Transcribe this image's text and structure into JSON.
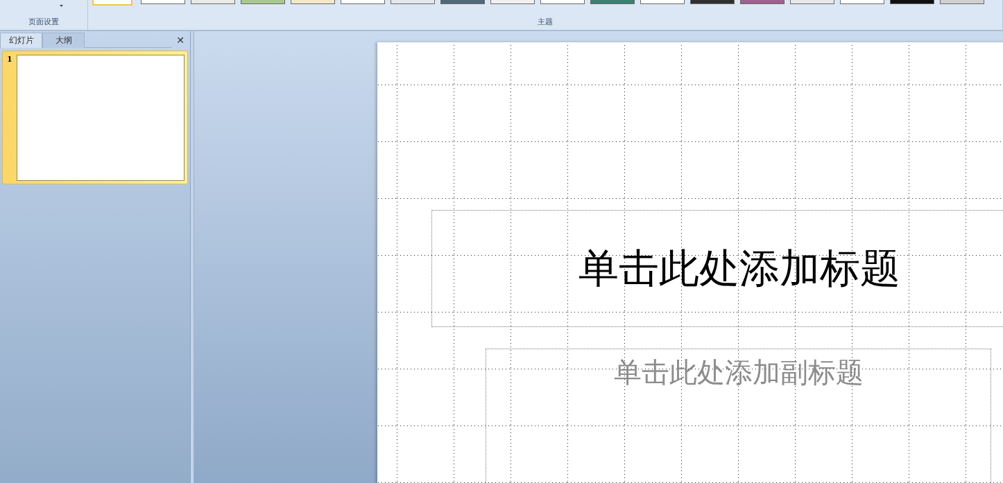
{
  "ribbon": {
    "groups": [
      {
        "label": "页面设置",
        "kind": "page_setup"
      },
      {
        "label": "主题",
        "kind": "themes"
      }
    ],
    "themes": [
      {
        "selected": true,
        "color": "#ffffff"
      },
      {
        "selected": false,
        "color": "#ffffff"
      },
      {
        "selected": false,
        "color": "#e8ece4"
      },
      {
        "selected": false,
        "color": "#a8c890"
      },
      {
        "selected": false,
        "color": "#f4e8c8"
      },
      {
        "selected": false,
        "color": "#ffffff"
      },
      {
        "selected": false,
        "color": "#e4e8ec"
      },
      {
        "selected": false,
        "color": "#506878"
      },
      {
        "selected": false,
        "color": "#f0f0f0"
      },
      {
        "selected": false,
        "color": "#ffffff"
      },
      {
        "selected": false,
        "color": "#3a8070"
      },
      {
        "selected": false,
        "color": "#ffffff"
      },
      {
        "selected": false,
        "color": "#303030"
      },
      {
        "selected": false,
        "color": "#a06090"
      },
      {
        "selected": false,
        "color": "#e8e8e8"
      },
      {
        "selected": false,
        "color": "#ffffff"
      },
      {
        "selected": false,
        "color": "#101010"
      },
      {
        "selected": false,
        "color": "#d0d0d0"
      }
    ]
  },
  "panel": {
    "tabs": [
      {
        "label": "幻灯片",
        "selected": true
      },
      {
        "label": "大纲",
        "selected": false
      }
    ],
    "close": "✕",
    "slides": [
      {
        "number": "1",
        "selected": true
      }
    ]
  },
  "slide": {
    "title": "单击此处添加标题",
    "subtitle": "单击此处添加副标题"
  }
}
